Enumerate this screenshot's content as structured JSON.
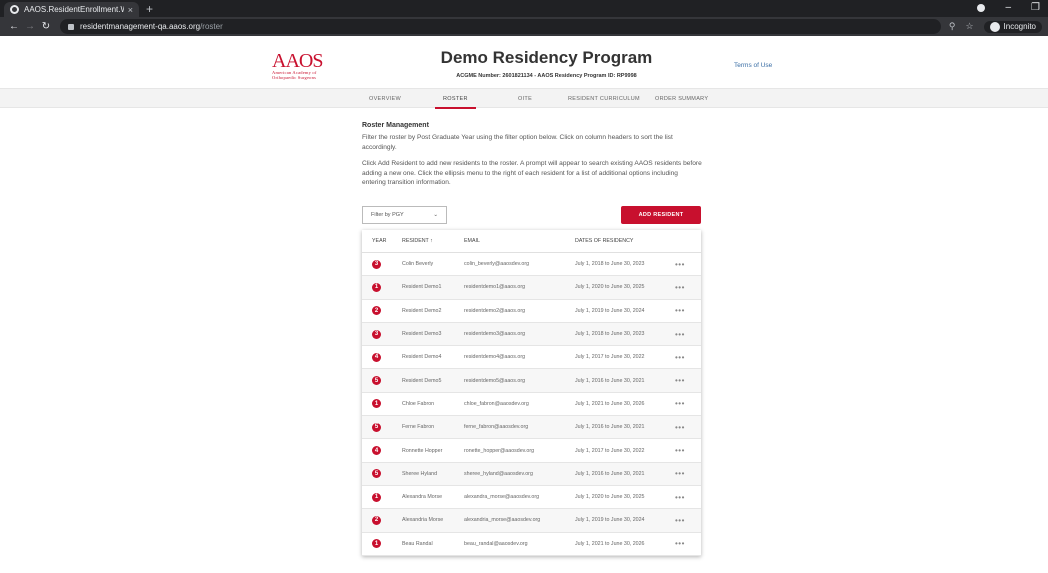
{
  "browser": {
    "tab_title": "AAOS.ResidentEnrollment.Web",
    "tab_close": "×",
    "new_tab": "+",
    "url_host": "residentmanagement-qa.aaos.org",
    "url_path": "/roster",
    "incognito_label": "Incognito"
  },
  "header": {
    "logo_mark": "AAOS",
    "logo_sub_1": "American Academy of",
    "logo_sub_2": "Orthopaedic Surgeons",
    "program_title": "Demo Residency Program",
    "program_meta": "ACGME Number: 2601821134  -  AAOS Residency Program ID: RP9998",
    "terms_link": "Terms of Use"
  },
  "nav": {
    "items": [
      "OVERVIEW",
      "ROSTER",
      "OITE",
      "RESIDENT CURRICULUM",
      "ORDER SUMMARY"
    ],
    "active": "ROSTER"
  },
  "roster": {
    "heading": "Roster Management",
    "para1": "Filter the roster by Post Graduate Year using the filter option below. Click on column headers to sort the list accordingly.",
    "para2": "Click Add Resident to add new residents to the roster. A prompt will appear to search existing AAOS residents before adding a new one. Click the ellipsis menu to the right of each resident for a list of additional options including entering transition information.",
    "filter_label": "Filter by PGY",
    "add_button": "ADD RESIDENT"
  },
  "table": {
    "headers": {
      "year": "YEAR",
      "resident": "RESIDENT ↑",
      "email": "EMAIL",
      "dates": "DATES OF RESIDENCY"
    },
    "rows": [
      {
        "year": "3",
        "name": "Colin Beverly",
        "email": "colin_beverly@aaosdev.org",
        "dates": "July 1, 2018 to June 30, 2023"
      },
      {
        "year": "1",
        "name": "Resident Demo1",
        "email": "residentdemo1@aaos.org",
        "dates": "July 1, 2020 to June 30, 2025"
      },
      {
        "year": "2",
        "name": "Resident Demo2",
        "email": "residentdemo2@aaos.org",
        "dates": "July 1, 2019 to June 30, 2024"
      },
      {
        "year": "3",
        "name": "Resident Demo3",
        "email": "residentdemo3@aaos.org",
        "dates": "July 1, 2018 to June 30, 2023"
      },
      {
        "year": "4",
        "name": "Resident Demo4",
        "email": "residentdemo4@aaos.org",
        "dates": "July 1, 2017 to June 30, 2022"
      },
      {
        "year": "5",
        "name": "Resident Demo5",
        "email": "residentdemo5@aaos.org",
        "dates": "July 1, 2016 to June 30, 2021"
      },
      {
        "year": "1",
        "name": "Chloe Fabron",
        "email": "chloe_fabron@aaosdev.org",
        "dates": "July 1, 2021 to June 30, 2026"
      },
      {
        "year": "5",
        "name": "Ferne Fabron",
        "email": "ferne_fabron@aaosdev.org",
        "dates": "July 1, 2016 to June 30, 2021"
      },
      {
        "year": "4",
        "name": "Ronnette Hopper",
        "email": "ronette_hopper@aaosdev.org",
        "dates": "July 1, 2017 to June 30, 2022"
      },
      {
        "year": "5",
        "name": "Sheree Hyland",
        "email": "sheree_hyland@aaosdev.org",
        "dates": "July 1, 2016 to June 30, 2021"
      },
      {
        "year": "1",
        "name": "Alexandra Morse",
        "email": "alexandra_morse@aaosdev.org",
        "dates": "July 1, 2020 to June 30, 2025"
      },
      {
        "year": "2",
        "name": "Alexandria Morse",
        "email": "alexandria_morse@aaosdev.org",
        "dates": "July 1, 2019 to June 30, 2024"
      },
      {
        "year": "1",
        "name": "Beau Randal",
        "email": "beau_randal@aaosdev.org",
        "dates": "July 1, 2021 to June 30, 2026"
      }
    ],
    "more_glyph": "•••"
  },
  "colors": {
    "accent": "#c8102e",
    "link": "#3a6ea5"
  }
}
